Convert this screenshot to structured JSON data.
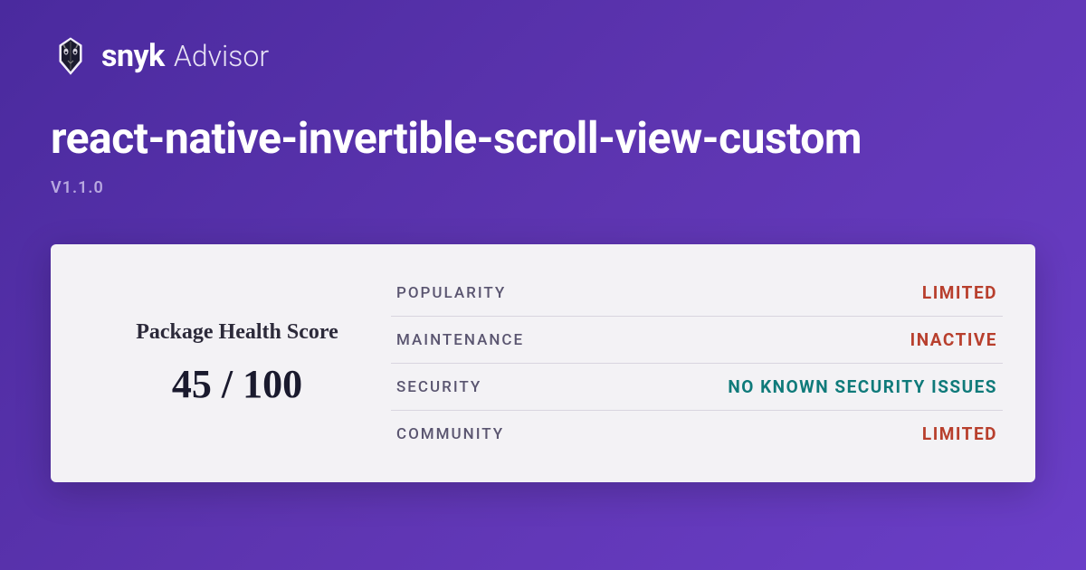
{
  "brand": {
    "name": "snyk",
    "sub": "Advisor"
  },
  "package": {
    "name": "react-native-invertible-scroll-view-custom",
    "version": "V1.1.0"
  },
  "score": {
    "label": "Package Health Score",
    "value": "45 / 100"
  },
  "metrics": [
    {
      "label": "POPULARITY",
      "value": "LIMITED",
      "statusClass": "status-limited"
    },
    {
      "label": "MAINTENANCE",
      "value": "INACTIVE",
      "statusClass": "status-inactive"
    },
    {
      "label": "SECURITY",
      "value": "NO KNOWN SECURITY ISSUES",
      "statusClass": "status-ok"
    },
    {
      "label": "COMMUNITY",
      "value": "LIMITED",
      "statusClass": "status-limited"
    }
  ]
}
